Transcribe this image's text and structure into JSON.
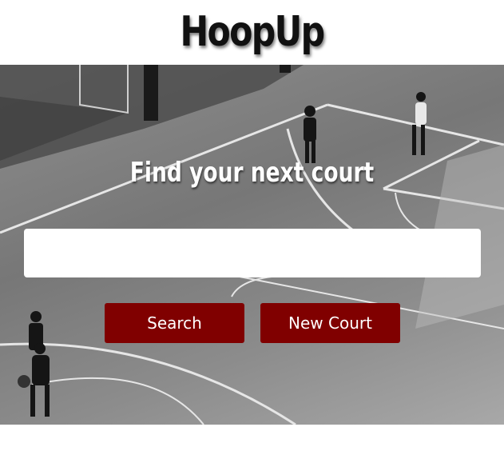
{
  "brand": {
    "name": "HoopUp"
  },
  "hero": {
    "headline": "Find your next court",
    "search": {
      "value": "",
      "placeholder": ""
    },
    "buttons": {
      "search": "Search",
      "new_court": "New Court"
    }
  },
  "colors": {
    "button_bg": "#800000",
    "button_text": "#ffffff"
  },
  "background_image": "black-and-white photo of people playing on an outdoor basketball court"
}
